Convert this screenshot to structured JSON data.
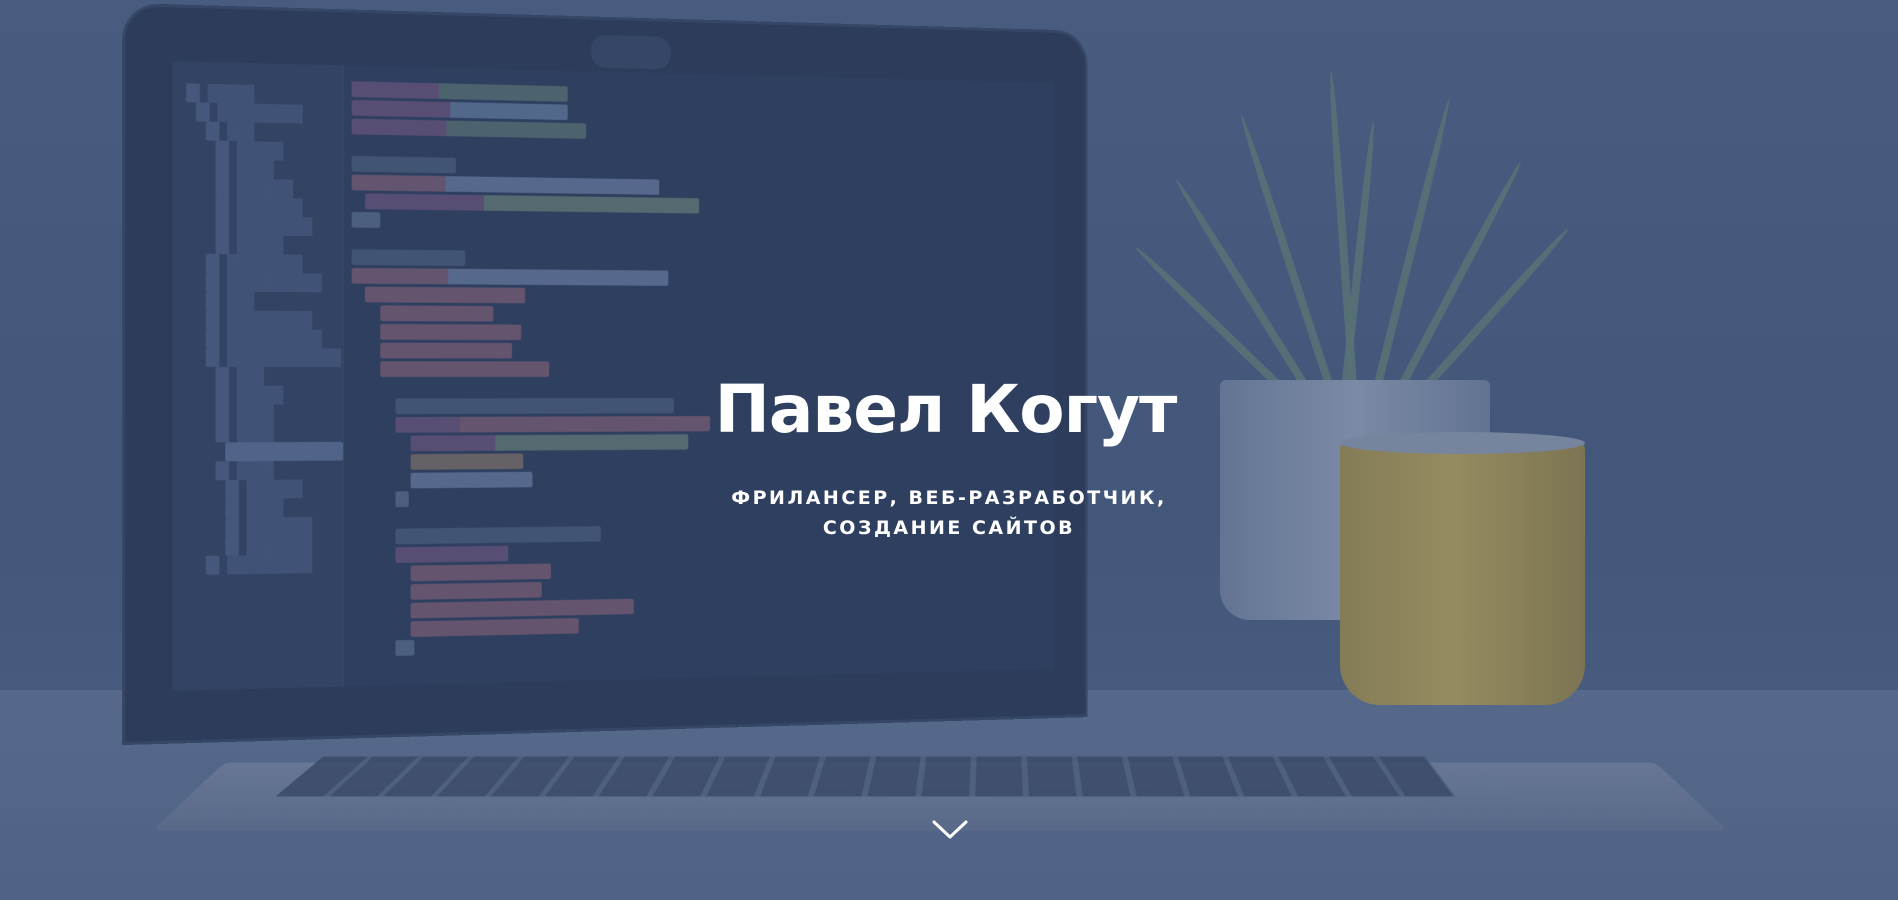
{
  "hero": {
    "title": "Павел Когут",
    "subtitle_line1": "ФРИЛАНСЕР, ВЕБ-РАЗРАБОТЧИК,",
    "subtitle_line2": "СОЗДАНИЕ САЙТОВ"
  },
  "icons": {
    "scroll": "chevron-down-icon"
  },
  "colors": {
    "overlay": "#30466e",
    "text": "#ffffff"
  }
}
